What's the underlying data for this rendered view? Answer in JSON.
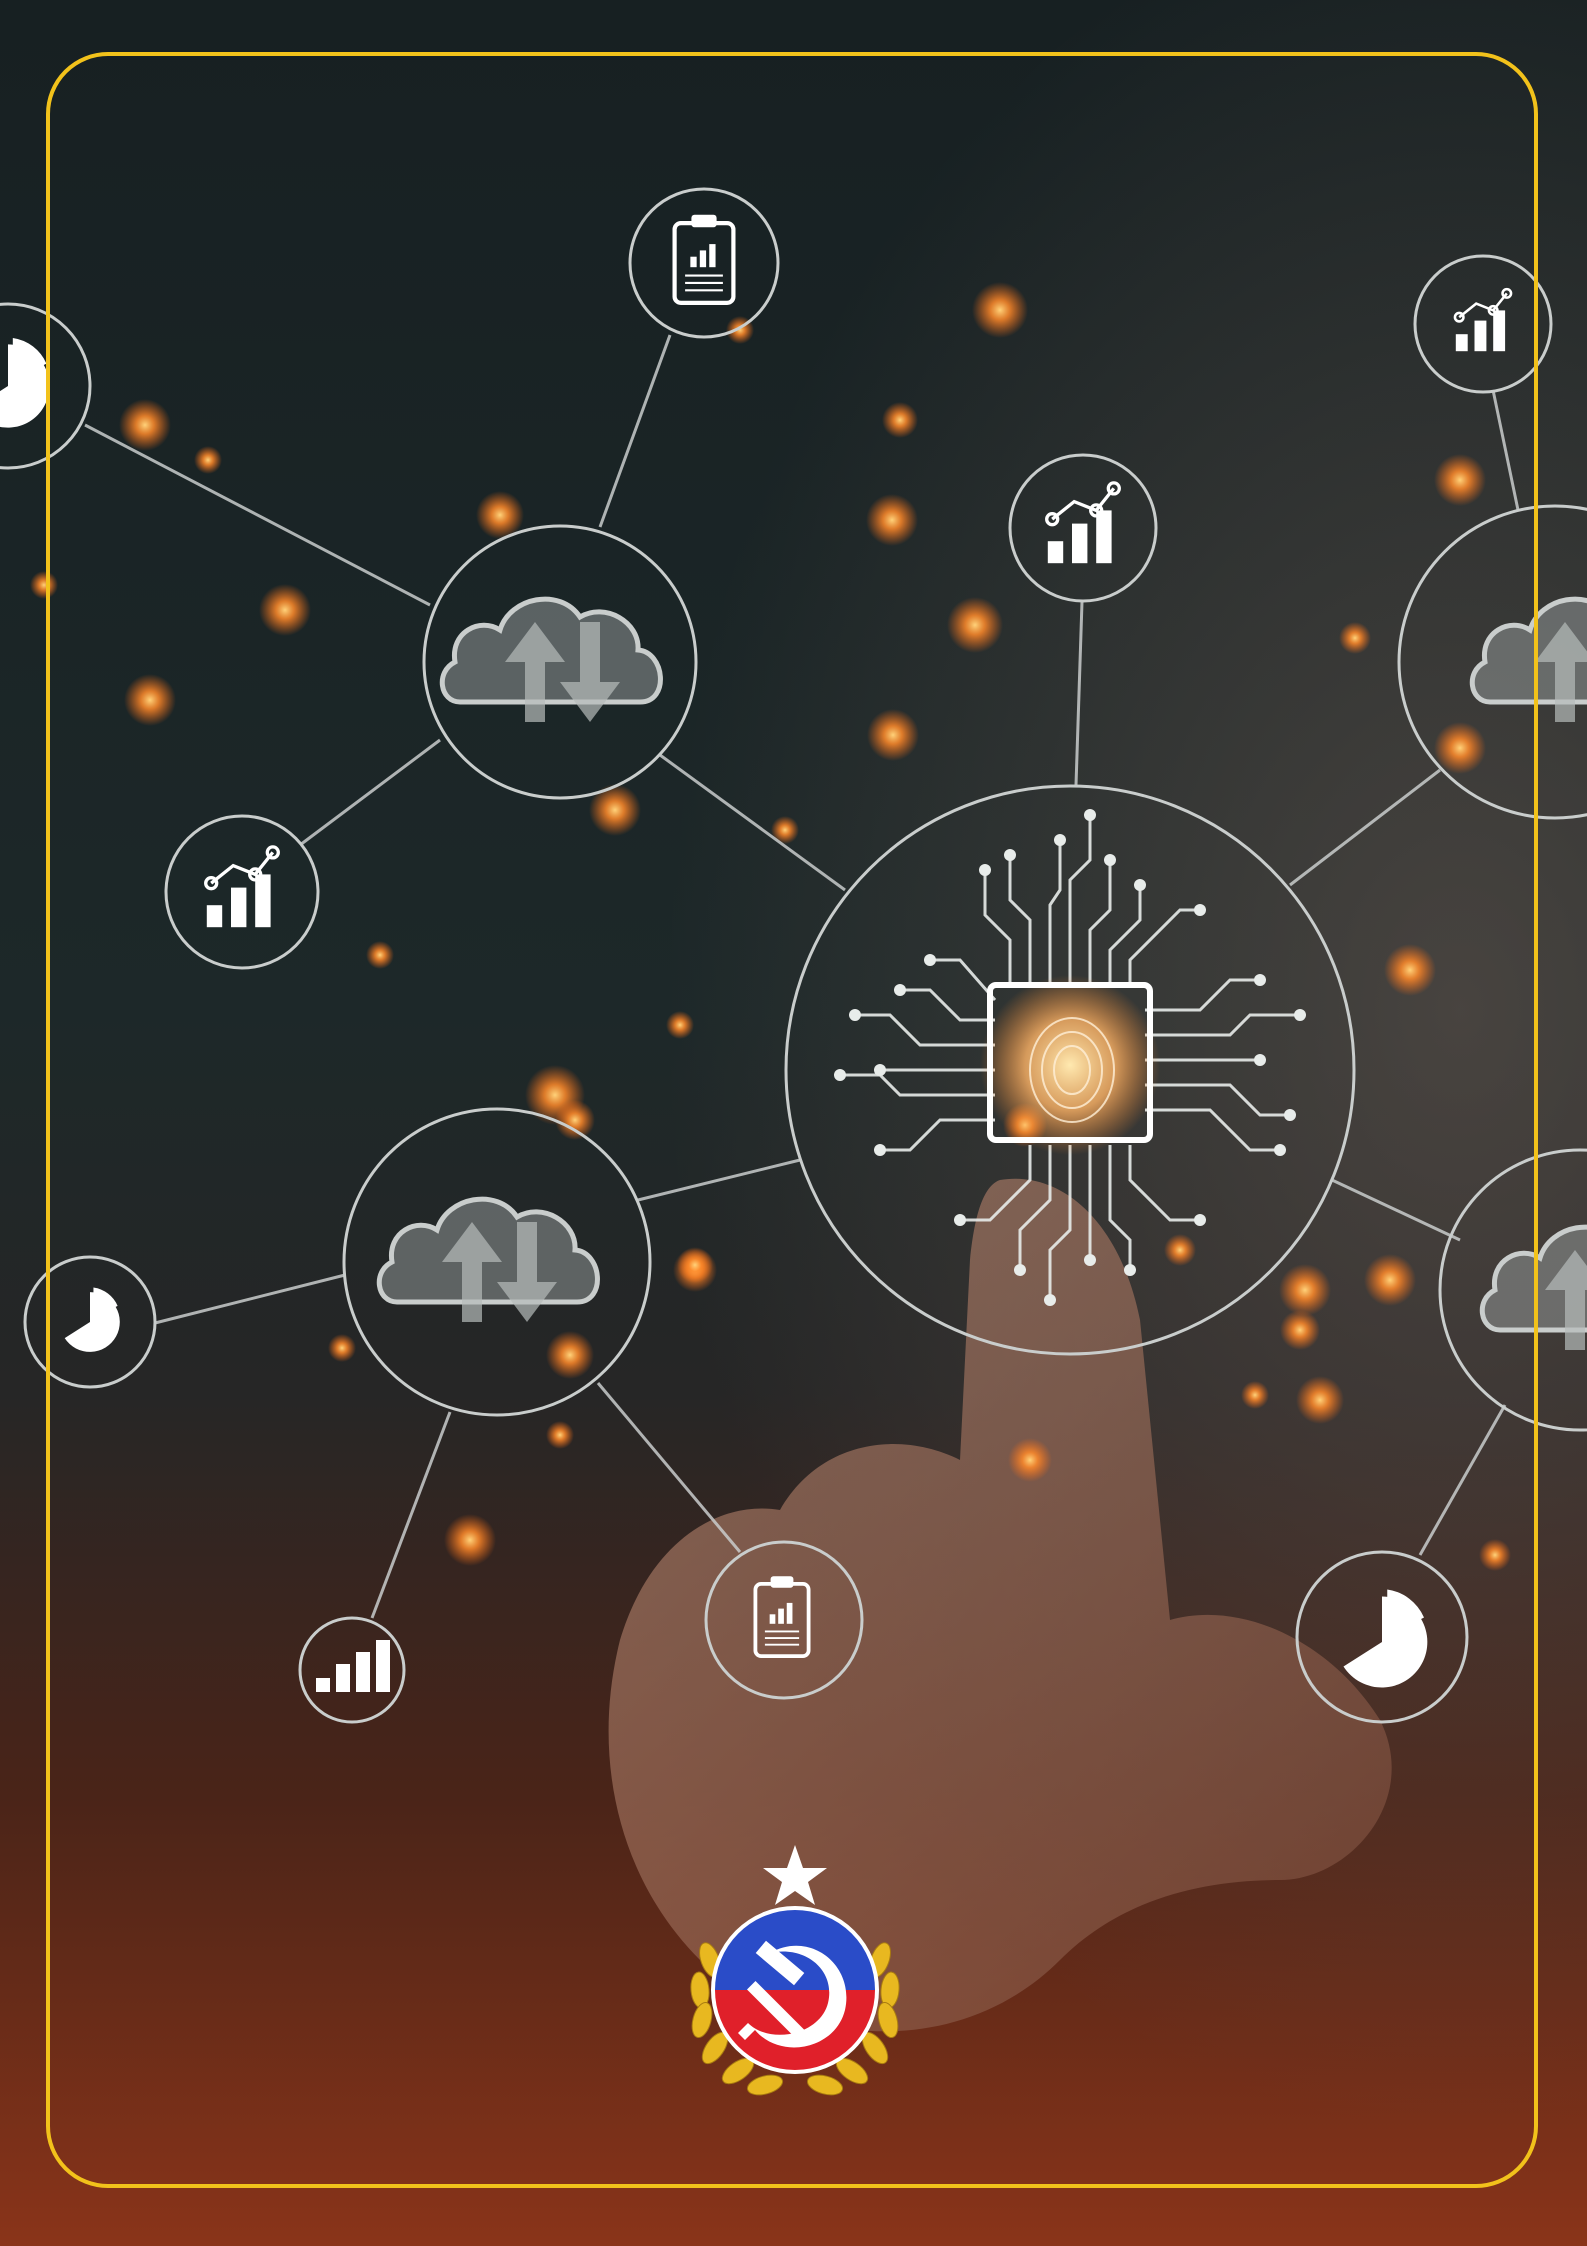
{
  "colors": {
    "frame_border": "#f2c21b",
    "background_dark": "#1c2628",
    "background_warm": "#7d2c1a",
    "network_line": "#c9cdcc",
    "glow_dot": "#ff8a2a",
    "emblem_blue": "#2a4cc8",
    "emblem_red": "#e0202a",
    "emblem_gold": "#e8b820"
  },
  "icons": {
    "document_chart": "clipboard-bar-chart-icon",
    "growth_chart": "bar-line-growth-chart-icon",
    "pie_chart": "pie-chart-icon",
    "cloud_sync": "cloud-upload-download-icon",
    "chip": "fingerprint-chip-icon",
    "emblem": "hammer-sickle-emblem-icon",
    "star": "star-icon"
  }
}
